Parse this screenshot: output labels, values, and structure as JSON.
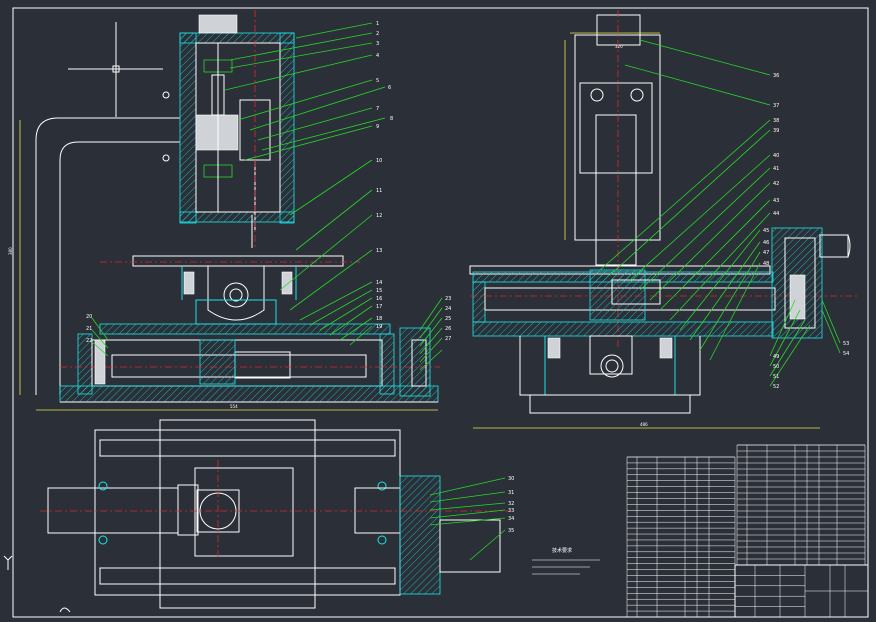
{
  "drawing": {
    "frame_color": "#ffffff",
    "accent_cyan": "#19e6e6",
    "leader_green": "#27d827",
    "centerline_red": "#e02a2a",
    "dimension_yellow": "#e8e84a",
    "background": "#2b2f38"
  },
  "front_view": {
    "labels": [
      "1",
      "2",
      "3",
      "4",
      "5",
      "6",
      "7",
      "8",
      "9",
      "10",
      "11",
      "12",
      "13",
      "14",
      "15",
      "16",
      "17",
      "18",
      "19",
      "20",
      "21",
      "22",
      "23",
      "24",
      "25",
      "26",
      "27"
    ]
  },
  "side_view": {
    "labels": [
      "36",
      "37",
      "38",
      "39",
      "40",
      "41",
      "42",
      "43",
      "44",
      "45",
      "46",
      "47",
      "48",
      "49",
      "50",
      "51",
      "52",
      "53",
      "54"
    ]
  },
  "top_view": {
    "labels": [
      "30",
      "31",
      "32",
      "33",
      "34",
      "35"
    ]
  },
  "tech_notes_title": "技术要求"
}
